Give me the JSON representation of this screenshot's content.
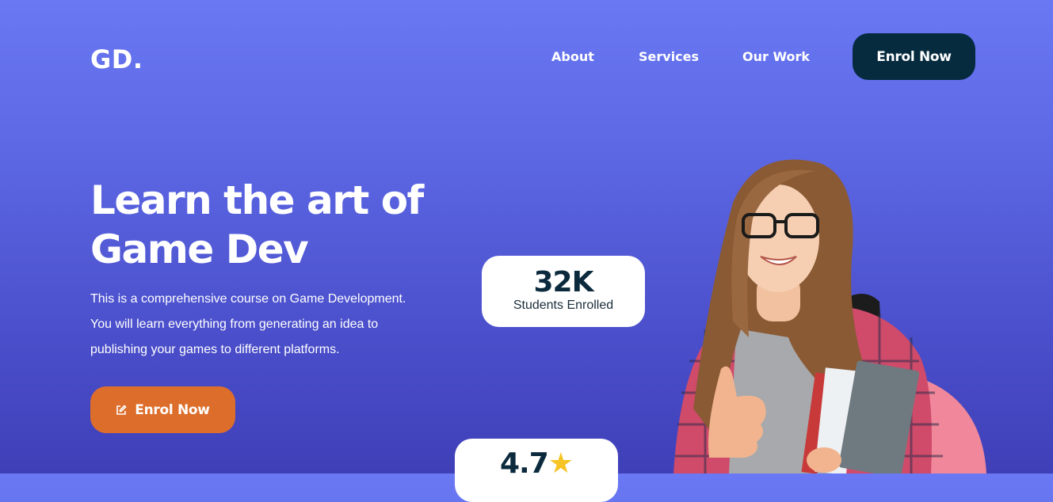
{
  "header": {
    "logo": "GD.",
    "nav": [
      "About",
      "Services",
      "Our Work"
    ],
    "cta_label": "Enrol Now"
  },
  "hero": {
    "title_line1": "Learn the art of",
    "title_line2": "Game Dev",
    "description_line1": "This is a comprehensive course on Game Development.",
    "description_line2": "You will learn everything from generating an idea to",
    "description_line3": "publishing your games to different platforms.",
    "cta_label": "Enrol Now",
    "cta_icon": "edit-icon"
  },
  "stats": {
    "students_value": "32K",
    "students_label": "Students Enrolled",
    "rating_value": "4.7",
    "rating_icon": "star-icon"
  },
  "colors": {
    "nav_cta_bg": "#062b3f",
    "hero_cta_bg": "#dd6d2a",
    "star": "#f7c425"
  }
}
